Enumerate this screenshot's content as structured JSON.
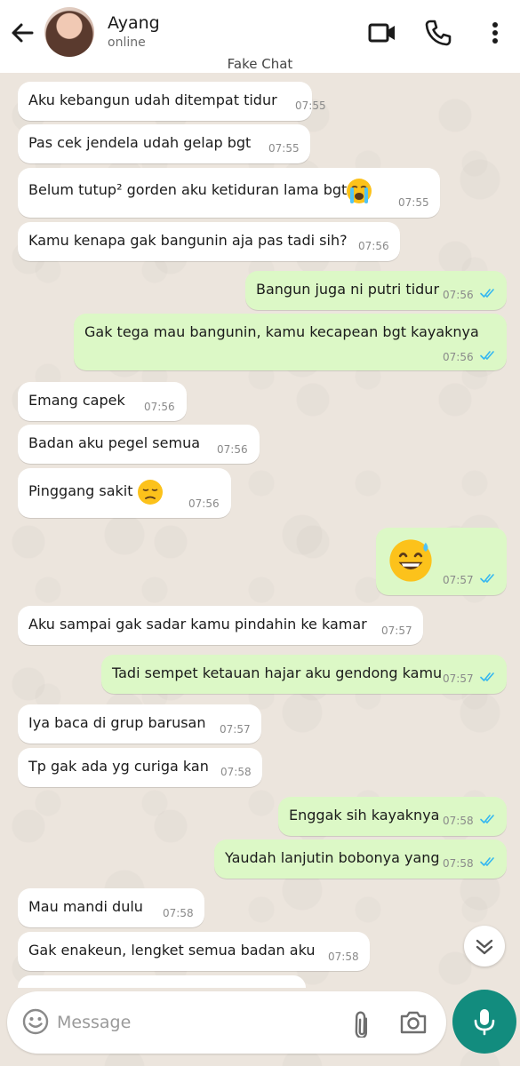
{
  "header": {
    "contact_name": "Ayang",
    "status": "online",
    "label": "Fake Chat"
  },
  "messages": [
    {
      "dir": "in",
      "text": "Aku kebangun udah ditempat tidur",
      "time": "07:55"
    },
    {
      "dir": "in",
      "text": "Pas cek jendela udah gelap bgt",
      "time": "07:55"
    },
    {
      "dir": "in",
      "text": "Belum tutup² gorden aku ketiduran lama bgt",
      "emoji": "crying-face",
      "time": "07:55"
    },
    {
      "dir": "in",
      "text": "Kamu kenapa gak bangunin aja pas tadi sih?",
      "time": "07:56"
    },
    {
      "dir": "out",
      "text": "Bangun juga ni putri tidur",
      "time": "07:56",
      "read": true
    },
    {
      "dir": "out",
      "text": "Gak tega mau bangunin, kamu kecapean bgt kayaknya",
      "time": "07:56",
      "read": true
    },
    {
      "dir": "in",
      "text": "Emang capek",
      "time": "07:56"
    },
    {
      "dir": "in",
      "text": "Badan aku pegel semua",
      "time": "07:56"
    },
    {
      "dir": "in",
      "text": "Pinggang sakit",
      "emoji": "pensive-face",
      "time": "07:56"
    },
    {
      "dir": "out",
      "text": "",
      "emoji": "grinning-sweat-face",
      "time": "07:57",
      "read": true
    },
    {
      "dir": "in",
      "text": "Aku sampai gak sadar kamu pindahin ke kamar",
      "time": "07:57"
    },
    {
      "dir": "out",
      "text": "Tadi sempet ketauan hajar aku gendong kamu",
      "time": "07:57",
      "read": true
    },
    {
      "dir": "in",
      "text": "Iya baca di grup barusan",
      "time": "07:57"
    },
    {
      "dir": "in",
      "text": "Tp gak ada yg curiga kan",
      "time": "07:58"
    },
    {
      "dir": "out",
      "text": "Enggak sih kayaknya",
      "time": "07:58",
      "read": true
    },
    {
      "dir": "out",
      "text": "Yaudah lanjutin bobonya yang",
      "time": "07:58",
      "read": true
    },
    {
      "dir": "in",
      "text": "Mau mandi dulu",
      "time": "07:58"
    },
    {
      "dir": "in",
      "text": "Gak enakeun, lengket semua badan aku",
      "time": "07:58"
    }
  ],
  "composer": {
    "placeholder": "Message"
  },
  "colors": {
    "incoming_bubble": "#ffffff",
    "outgoing_bubble": "#dcf8c6",
    "read_ticks": "#34b7f1",
    "mic_button": "#128c7e",
    "chat_background": "#ece5dd"
  },
  "icons": [
    "back-arrow-icon",
    "video-call-icon",
    "phone-call-icon",
    "more-options-icon",
    "emoji-icon",
    "attach-icon",
    "camera-icon",
    "mic-icon",
    "chevron-double-down-icon",
    "double-check-icon"
  ]
}
